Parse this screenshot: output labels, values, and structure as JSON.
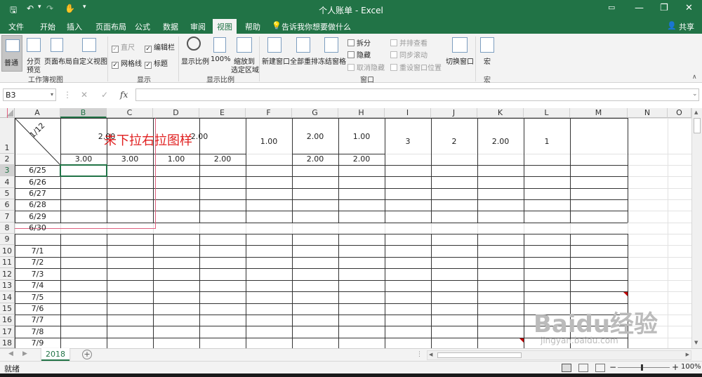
{
  "window": {
    "title": "个人账单 - Excel"
  },
  "tabs": [
    {
      "label": "文件"
    },
    {
      "label": "开始"
    },
    {
      "label": "插入"
    },
    {
      "label": "页面布局"
    },
    {
      "label": "公式"
    },
    {
      "label": "数据"
    },
    {
      "label": "审阅"
    },
    {
      "label": "视图"
    },
    {
      "label": "帮助"
    }
  ],
  "search": {
    "label": "告诉我你想要做什么"
  },
  "share": {
    "label": "共享"
  },
  "ribbon": {
    "normal": "普通",
    "page_break_preview_1": "分页",
    "page_break_preview_2": "预览",
    "page_layout": "页面布局",
    "custom_views": "自定义视图",
    "workbook_views_group": "工作簿视图",
    "ruler": "直尺",
    "formula_bar": "编辑栏",
    "gridlines": "网格线",
    "headings": "标题",
    "show_group": "显示",
    "zoom": "显示比例",
    "zoom_100": "100%",
    "zoom_to_selection_1": "缩放到",
    "zoom_to_selection_2": "选定区域",
    "zoom_group": "显示比例",
    "new_window": "新建窗口",
    "arrange_all": "全部重排",
    "freeze_panes": "冻结窗格",
    "split": "拆分",
    "hide": "隐藏",
    "unhide": "取消隐藏",
    "view_side_by_side": "并排查看",
    "sync_scrolling": "同步滚动",
    "reset_window_position": "重设窗口位置",
    "window_group": "窗口",
    "switch_windows": "切换窗口",
    "macros": "宏",
    "macros_group": "宏"
  },
  "formula_bar": {
    "name_box": "B3",
    "fx": "fx",
    "cancel": "✕",
    "enter": "✓"
  },
  "columns": [
    "A",
    "B",
    "C",
    "D",
    "E",
    "F",
    "G",
    "H",
    "I",
    "J",
    "K",
    "L",
    "M",
    "N",
    "O"
  ],
  "rows": [
    "1",
    "2",
    "3",
    "4",
    "5",
    "6",
    "7",
    "8",
    "9",
    "10",
    "11",
    "12",
    "13",
    "14",
    "15",
    "16",
    "17",
    "18"
  ],
  "cells": {
    "a1": "1/12",
    "b1": "2.00",
    "d1": "2.00",
    "f1": "1.00",
    "g1": "2.00",
    "h1": "1.00",
    "i1": "3",
    "j1": "2",
    "k1": "2.00",
    "l1": "1",
    "b2": "3.00",
    "c2": "3.00",
    "d2": "1.00",
    "e2": "2.00",
    "g2": "2.00",
    "h2": "2.00",
    "dates": [
      "6/25",
      "6/26",
      "6/27",
      "6/28",
      "6/29",
      "6/30",
      "",
      "7/1",
      "7/2",
      "7/3",
      "7/4",
      "7/5",
      "7/6",
      "7/7",
      "7/8",
      "7/9"
    ]
  },
  "annotation": {
    "text": "未下拉右拉图样"
  },
  "sheet_tab": {
    "name": "2018",
    "add": "+"
  },
  "status": {
    "ready": "就绪",
    "zoom": "100%"
  },
  "watermark": {
    "line1": "Baidu经验",
    "line2": "jingyan.baidu.com"
  },
  "colors": {
    "excel_green": "#217346",
    "annotation_red": "#e02020"
  }
}
